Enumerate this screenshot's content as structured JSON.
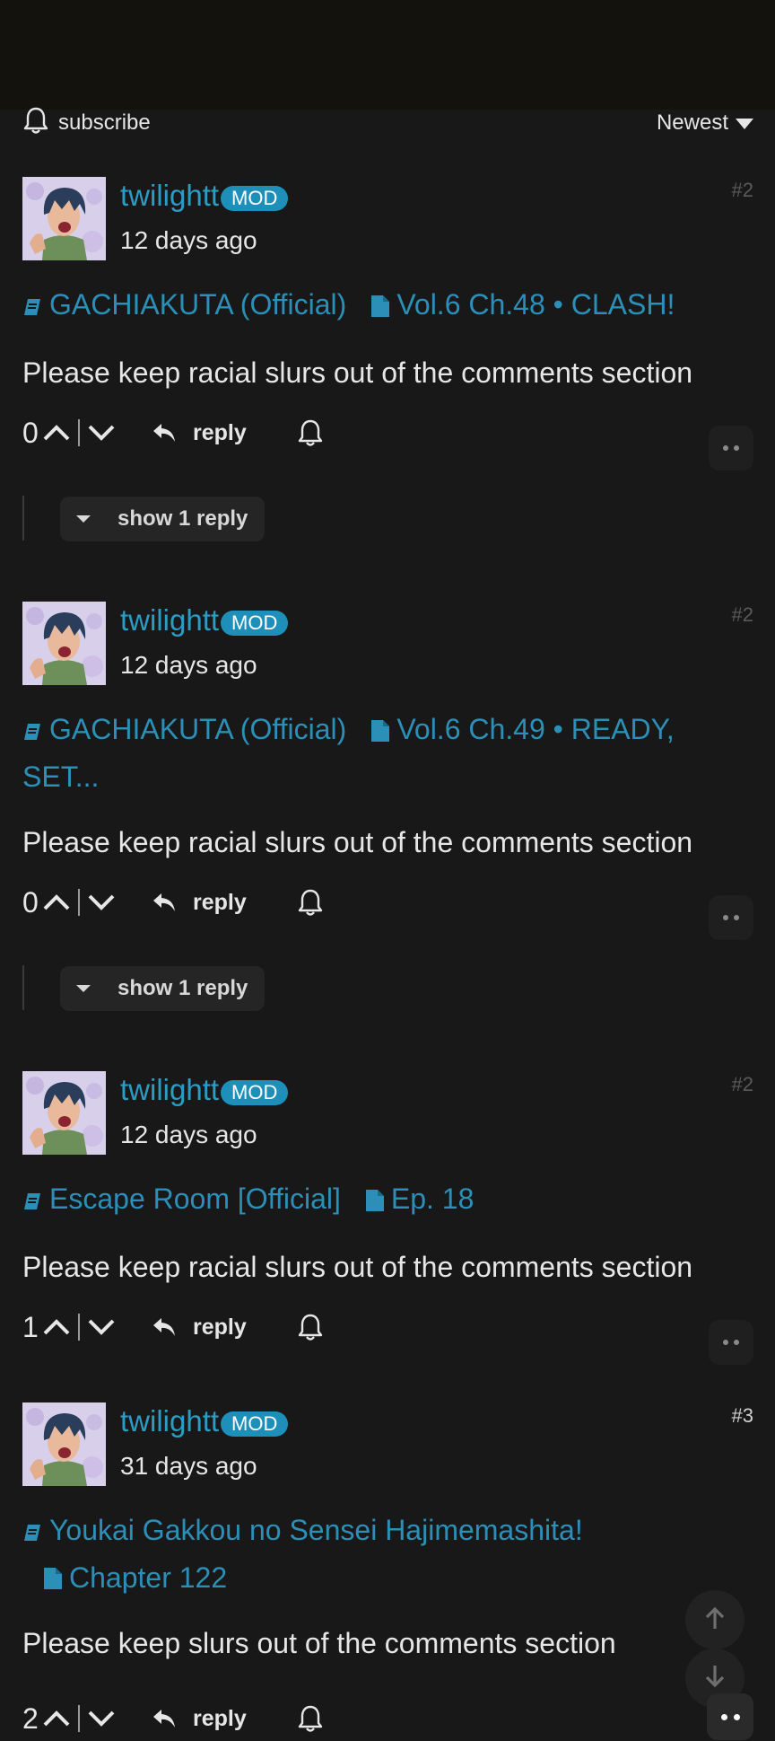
{
  "toolbar": {
    "subscribe_label": "subscribe",
    "sort_label": "Newest"
  },
  "mod_badge": "MOD",
  "reply_label": "reply",
  "comments": [
    {
      "username": "twilightt",
      "time": "12 days ago",
      "comment_number": "#2",
      "series": "GACHIAKUTA (Official)",
      "chapter": "Vol.6 Ch.48 • CLASH!",
      "text": "Please keep racial slurs out of the comments section",
      "score": "0",
      "show_replies": "show 1 reply"
    },
    {
      "username": "twilightt",
      "time": "12 days ago",
      "comment_number": "#2",
      "series": "GACHIAKUTA (Official)",
      "chapter": "Vol.6 Ch.49 • READY, SET...",
      "text": "Please keep racial slurs out of the comments section",
      "score": "0",
      "show_replies": "show 1 reply"
    },
    {
      "username": "twilightt",
      "time": "12 days ago",
      "comment_number": "#2",
      "series": "Escape Room [Official]",
      "chapter": "Ep. 18",
      "text": "Please keep racial slurs out of the comments section",
      "score": "1"
    },
    {
      "username": "twilightt",
      "time": "31 days ago",
      "comment_number": "#3",
      "series": "Youkai Gakkou no Sensei Hajimemashita!",
      "chapter": "Chapter 122",
      "text": "Please keep slurs out of the comments section",
      "score": "2"
    }
  ],
  "colors": {
    "background": "#181818",
    "link": "#2b8fb8",
    "mod_badge": "#1d8fb9",
    "text": "#e6e6e6"
  },
  "icons": [
    "bell-icon",
    "chevron-down-icon",
    "book-icon",
    "file-icon",
    "arrow-up-icon",
    "chevron-up-icon",
    "reply-icon",
    "more-dots-icon",
    "arrow-down-icon"
  ]
}
